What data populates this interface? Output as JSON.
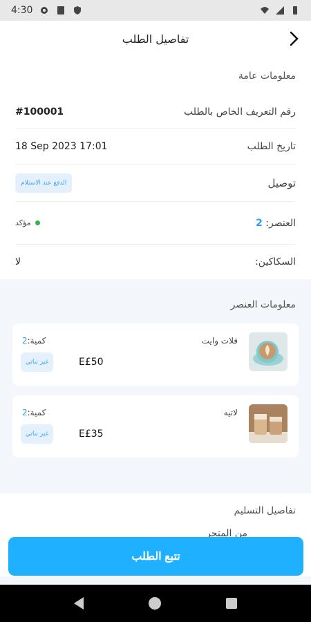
{
  "status_bar": {
    "time": "4:30"
  },
  "header": {
    "title": "تفاصيل الطلب"
  },
  "general": {
    "title": "معلومات عامة",
    "order_id_label": "رقم التعريف الخاص بالطلب",
    "order_id_value": "#100001",
    "order_date_label": "تاريخ الطلب",
    "order_date_value": "18 Sep 2023  17:01",
    "delivery_label": "توصيل",
    "payment_badge": "الدفع عند الاستلام",
    "items_label": "العنصر:",
    "items_count": "2",
    "status_text": "مؤكد",
    "cutlery_label": "السكاكين:",
    "cutlery_value": "لا"
  },
  "items_section": {
    "title": "معلومات العنصر",
    "items": [
      {
        "name": "فلات وايت",
        "qty_label": "كمية:",
        "qty_value": "2",
        "tag": "غير نباتي",
        "price": "E£50"
      },
      {
        "name": "لاتيه",
        "qty_label": "كمية:",
        "qty_value": "2",
        "tag": "غير نباتي",
        "price": "E£35"
      }
    ]
  },
  "delivery_section": {
    "title": "تفاصيل التسليم",
    "from_label": "من المتجر"
  },
  "track_button": {
    "label": "تتبع الطلب"
  },
  "colors": {
    "accent": "#1fb0ff",
    "badge_bg": "#e4f1fd",
    "status_green": "#2fb84a"
  }
}
